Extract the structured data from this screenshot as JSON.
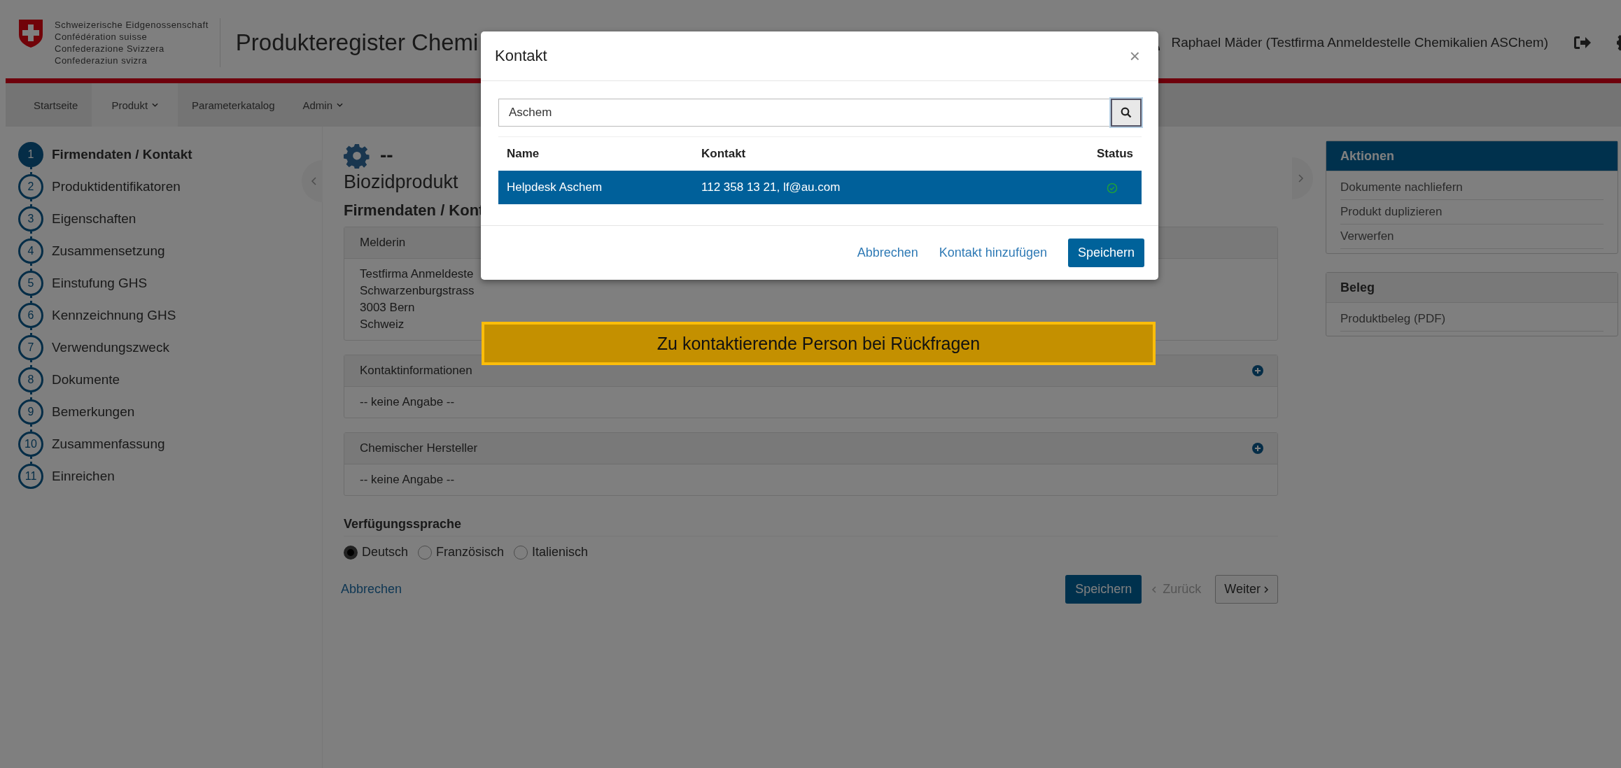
{
  "header": {
    "federation_lines": [
      "Schweizerische Eidgenossenschaft",
      "Confédération suisse",
      "Confederazione Svizzera",
      "Confederaziun svizra"
    ],
    "title": "Produkteregister Chemi",
    "user": "Raphael Mäder (Testfirma Anmeldestelle Chemikalien ASChem)"
  },
  "nav": [
    {
      "label": "Startseite",
      "selected": false,
      "dropdown": false
    },
    {
      "label": "Produkt",
      "selected": true,
      "dropdown": true
    },
    {
      "label": "Parameterkatalog",
      "selected": false,
      "dropdown": false
    },
    {
      "label": "Admin",
      "selected": false,
      "dropdown": true
    }
  ],
  "steps": [
    {
      "number": "1",
      "label": "Firmendaten / Kontakt",
      "selected": true
    },
    {
      "number": "2",
      "label": "Produktidentifikatoren",
      "selected": false
    },
    {
      "number": "3",
      "label": "Eigenschaften",
      "selected": false
    },
    {
      "number": "4",
      "label": "Zusammensetzung",
      "selected": false
    },
    {
      "number": "5",
      "label": "Einstufung GHS",
      "selected": false
    },
    {
      "number": "6",
      "label": "Kennzeichnung GHS",
      "selected": false
    },
    {
      "number": "7",
      "label": "Verwendungszweck",
      "selected": false
    },
    {
      "number": "8",
      "label": "Dokumente",
      "selected": false
    },
    {
      "number": "9",
      "label": "Bemerkungen",
      "selected": false
    },
    {
      "number": "10",
      "label": "Zusammenfassung",
      "selected": false
    },
    {
      "number": "11",
      "label": "Einreichen",
      "selected": false
    }
  ],
  "main": {
    "product_id": "--",
    "product_type": "Biozidprodukt",
    "section_title": "Firmendaten / Kont",
    "panels": [
      {
        "title": "Melderin",
        "lines": [
          "Testfirma Anmeldeste",
          "Schwarzenburgstrass",
          "3003 Bern",
          "Schweiz"
        ],
        "addable": false
      },
      {
        "title": "Kontaktinformationen",
        "lines": [
          "-- keine Angabe --"
        ],
        "addable": true
      },
      {
        "title": "Chemischer Hersteller",
        "lines": [
          "-- keine Angabe --"
        ],
        "addable": true
      }
    ],
    "language": {
      "label": "Verfügungssprache",
      "options": [
        {
          "label": "Deutsch",
          "selected": true
        },
        {
          "label": "Französisch",
          "selected": false
        },
        {
          "label": "Italienisch",
          "selected": false
        }
      ]
    },
    "cancel": "Abbrechen",
    "save": "Speichern",
    "back": "Zurück",
    "next": "Weiter"
  },
  "right": [
    {
      "title": "Aktionen",
      "highlighted": true,
      "items": [
        "Dokumente nachliefern",
        "Produkt duplizieren",
        "Verwerfen"
      ]
    },
    {
      "title": "Beleg",
      "highlighted": false,
      "items": [
        "Produktbeleg (PDF)"
      ]
    }
  ],
  "modal": {
    "title": "Kontakt",
    "close": "×",
    "search": {
      "value": "Aschem"
    },
    "columns": [
      "Name",
      "Kontakt",
      "Status"
    ],
    "rows": [
      {
        "name": "Helpdesk Aschem",
        "contact": "112 358 13 21, lf@au.com",
        "selected": true
      }
    ],
    "buttons": [
      {
        "label": "Abbrechen",
        "kind": "link"
      },
      {
        "label": "Kontakt hinzufügen",
        "kind": "link"
      },
      {
        "label": "Speichern",
        "kind": "primary"
      }
    ]
  },
  "callout": "Zu kontaktierende Person bei Rückfragen"
}
